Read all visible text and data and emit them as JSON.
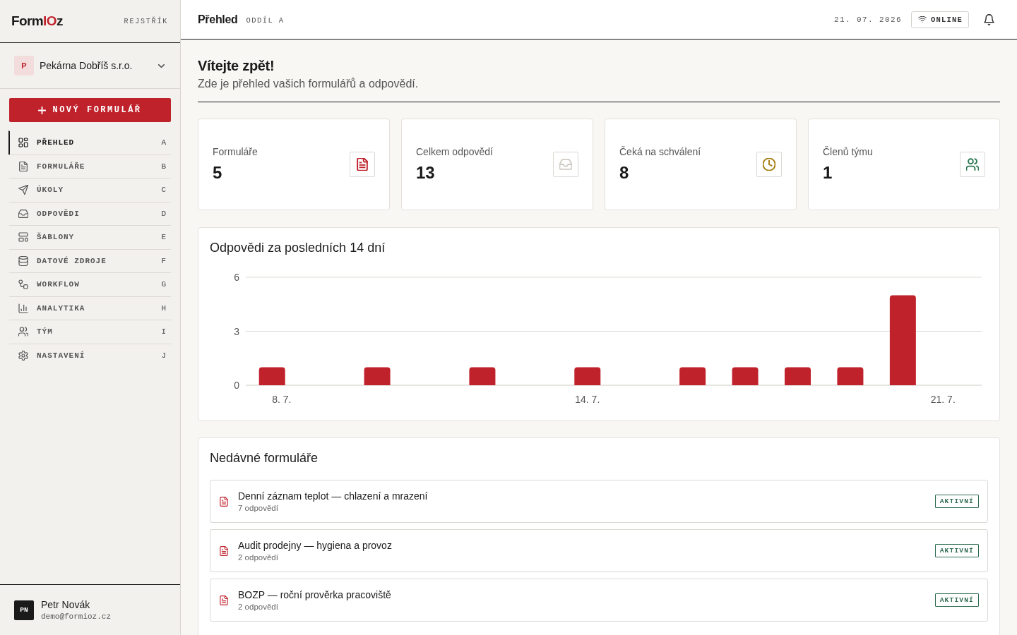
{
  "sidebar": {
    "logo": [
      {
        "text": "Form",
        "accent": false
      },
      {
        "text": "IO",
        "accent": true
      },
      {
        "text": "z",
        "accent": false
      }
    ],
    "index_link": "REJSTŘÍK",
    "organization": {
      "initial": "P",
      "name": "Pekárna Dobříš s.r.o."
    },
    "new_form_button": "NOVÝ FORMULÁŘ",
    "nav": [
      {
        "label": "PŘEHLED",
        "shortcut": "A",
        "selected": true
      },
      {
        "label": "FORMULÁŘE",
        "shortcut": "B",
        "selected": false
      },
      {
        "label": "ÚKOLY",
        "shortcut": "C",
        "selected": false
      },
      {
        "label": "ODPOVĚDI",
        "shortcut": "D",
        "selected": false
      },
      {
        "label": "ŠABLONY",
        "shortcut": "E",
        "selected": false
      },
      {
        "label": "DATOVÉ ZDROJE",
        "shortcut": "F",
        "selected": false
      },
      {
        "label": "WORKFLOW",
        "shortcut": "G",
        "selected": false
      },
      {
        "label": "ANALYTIKA",
        "shortcut": "H",
        "selected": false
      },
      {
        "label": "TÝM",
        "shortcut": "I",
        "selected": false
      },
      {
        "label": "NASTAVENÍ",
        "shortcut": "J",
        "selected": false
      }
    ],
    "user": {
      "initials": "PN",
      "name": "Petr Novák",
      "email": "demo@formioz.cz"
    }
  },
  "topbar": {
    "title": "Přehled",
    "section": "ODDÍL A",
    "date": "21. 07. 2026",
    "status": "ONLINE"
  },
  "welcome": {
    "title": "Vítejte zpět!",
    "subtitle": "Zde je přehled vašich formulářů a odpovědí."
  },
  "stats": [
    {
      "label": "Formuláře",
      "value": "5",
      "color": "#c0222c"
    },
    {
      "label": "Celkem odpovědí",
      "value": "13",
      "color": "#cfcac3"
    },
    {
      "label": "Čeká na schválení",
      "value": "8",
      "color": "#a27a0c"
    },
    {
      "label": "Členů týmu",
      "value": "1",
      "color": "#2f7a52"
    }
  ],
  "chart": {
    "chart_data": {
      "type": "bar",
      "title": "Odpovědi za posledních 14 dní",
      "categories": [
        "8. 7.",
        null,
        null,
        null,
        null,
        null,
        "14. 7.",
        null,
        null,
        null,
        null,
        null,
        null,
        "21. 7."
      ],
      "values": [
        1,
        0,
        1,
        0,
        1,
        0,
        1,
        0,
        1,
        1,
        1,
        1,
        5,
        0
      ],
      "ylim": [
        0,
        6
      ],
      "yticks": [
        0,
        3,
        6
      ]
    }
  },
  "recent_forms": {
    "title": "Nedávné formuláře",
    "items": [
      {
        "title": "Denní záznam teplot — chlazení a mrazení",
        "responses": "7 odpovědí",
        "status": "AKTIVNÍ"
      },
      {
        "title": "Audit prodejny — hygiena a provoz",
        "responses": "2 odpovědí",
        "status": "AKTIVNÍ"
      },
      {
        "title": "BOZP — roční prověrka pracoviště",
        "responses": "2 odpovědí",
        "status": "AKTIVNÍ"
      }
    ]
  }
}
